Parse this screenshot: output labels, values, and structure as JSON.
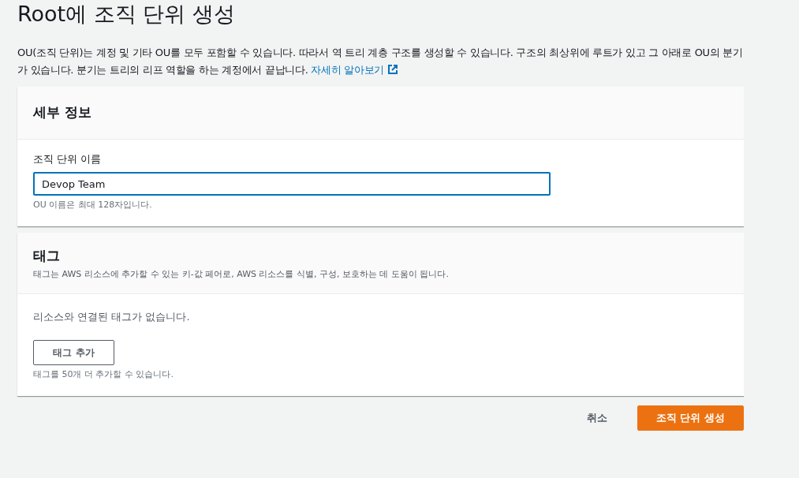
{
  "page_title": "Root에 조직 단위 생성",
  "description": {
    "text": "OU(조직 단위)는 계정 및 기타 OU를 모두 포함할 수 있습니다. 따라서 역 트리 계층 구조를 생성할 수 있습니다. 구조의 최상위에 루트가 있고 그 아래로 OU의 분기가 있습니다. 분기는 트리의 리프 역할을 하는 계정에서 끝납니다.",
    "link": "자세히 알아보기"
  },
  "details_panel": {
    "title": "세부 정보",
    "field": {
      "label": "조직 단위 이름",
      "value": "Devop Team",
      "focused": true,
      "hint": "OU 이름은 최대 128자입니다."
    }
  },
  "tags_panel": {
    "title": "태그",
    "subtitle": "태그는 AWS 리소스에 추가할 수 있는 키-값 페어로, AWS 리소스를 식별, 구성, 보호하는 데 도움이 됩니다.",
    "empty_text": "리소스와 연결된 태그가 없습니다.",
    "add_button": "태그 추가",
    "hint": "태그를 50개 더 추가할 수 있습니다."
  },
  "actions": {
    "cancel": "취소",
    "submit": "조직 단위 생성"
  }
}
